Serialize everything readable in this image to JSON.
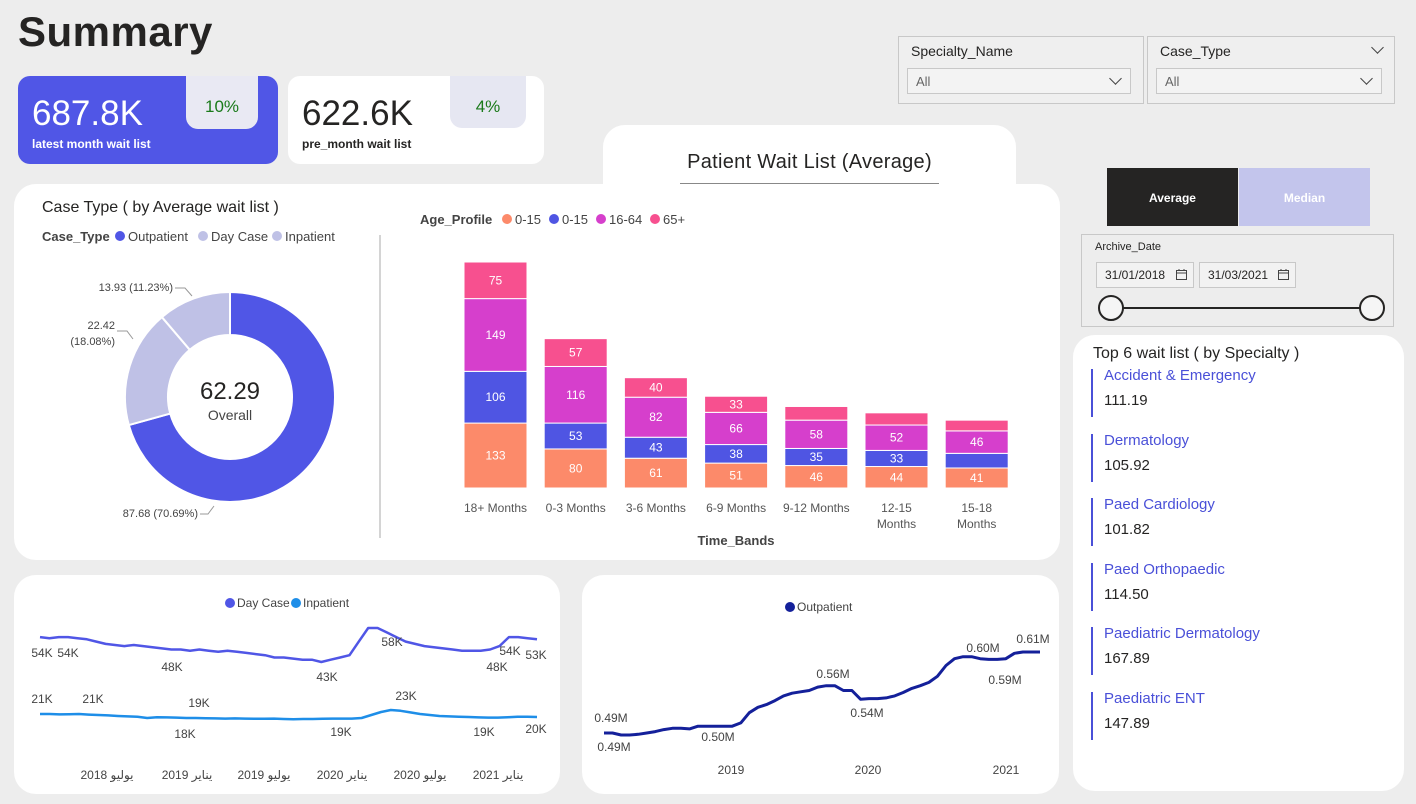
{
  "page": {
    "title": "Summary"
  },
  "kpis": [
    {
      "value": "687.8K",
      "label": "latest month wait list",
      "change": "10%"
    },
    {
      "value": "622.6K",
      "label": "pre_month wait list",
      "change": "4%"
    }
  ],
  "slicers": {
    "specialty": {
      "title": "Specialty_Name",
      "value": "All"
    },
    "case_type": {
      "title": "Case_Type",
      "value": "All"
    }
  },
  "main_title": "Patient Wait List (Average)",
  "stat_toggle": {
    "average": "Average",
    "median": "Median",
    "selected": "Average"
  },
  "date_slicer": {
    "title": "Archive_Date",
    "from": "31/01/2018",
    "to": "31/03/2021"
  },
  "top6": {
    "title": "Top 6 wait list ( by Specialty )",
    "items": [
      {
        "name": "Accident & Emergency",
        "value": "111.19"
      },
      {
        "name": "Dermatology",
        "value": "105.92"
      },
      {
        "name": "Paed Cardiology",
        "value": "101.82"
      },
      {
        "name": "Paed Orthopaedic",
        "value": "114.50"
      },
      {
        "name": "Paediatric Dermatology",
        "value": "167.89"
      },
      {
        "name": "Paediatric ENT",
        "value": "147.89"
      }
    ]
  },
  "colors": {
    "primary": "#5056e6",
    "outpatient": "#5056e6",
    "day_case": "#bfc1e6",
    "inpatient": "#bfc1e6",
    "age_0_15_a": "#fc8a6a",
    "age_0_15_b": "#4f55e3",
    "age_16_64": "#d63fcc",
    "age_65_plus": "#f7508f",
    "line_day_case": "#5056e6",
    "line_inpatient": "#1e8ee8",
    "line_outpatient": "#14209a"
  },
  "chart_data": [
    {
      "type": "pie",
      "title": "Case Type ( by Average wait list )",
      "legend_title": "Case_Type",
      "center_value": "62.29",
      "center_label": "Overall",
      "slices": [
        {
          "name": "Outpatient",
          "value": 87.68,
          "label": "87.68 (70.69%)"
        },
        {
          "name": "Day Case",
          "value": 22.42,
          "label": "22.42\n(18.08%)"
        },
        {
          "name": "Inpatient",
          "value": 13.93,
          "label": "13.93 (11.23%)"
        }
      ]
    },
    {
      "type": "bar",
      "stacked": true,
      "legend_title": "Age_Profile",
      "xlabel": "Time_Bands",
      "categories": [
        "18+ Months",
        "0-3 Months",
        "3-6 Months",
        "6-9 Months",
        "9-12 Months",
        "12-15 Months",
        "15-18 Months"
      ],
      "series": [
        {
          "name": "0-15",
          "values": [
            133,
            80,
            61,
            51,
            46,
            44,
            41
          ],
          "labels": [
            "133",
            "80",
            "61",
            "51",
            "46",
            "44",
            "41"
          ]
        },
        {
          "name": "0-15",
          "values": [
            106,
            53,
            43,
            38,
            35,
            33,
            30
          ],
          "labels": [
            "106",
            "53",
            "43",
            "38",
            "35",
            "33",
            ""
          ]
        },
        {
          "name": "16-64",
          "values": [
            149,
            116,
            82,
            66,
            58,
            52,
            46
          ],
          "labels": [
            "149",
            "116",
            "82",
            "66",
            "58",
            "52",
            "46"
          ]
        },
        {
          "name": "65+",
          "values": [
            75,
            57,
            40,
            33,
            28,
            25,
            22
          ],
          "labels": [
            "75",
            "57",
            "40",
            "33",
            "",
            "",
            ""
          ]
        }
      ]
    },
    {
      "type": "line",
      "x_ticks": [
        "يوليو 2018",
        "يناير 2019",
        "يوليو 2019",
        "يناير 2020",
        "يوليو 2020",
        "يناير 2021"
      ],
      "series": [
        {
          "name": "Day Case",
          "values": [
            54,
            53.5,
            54,
            54,
            53.5,
            53,
            52,
            51,
            50.5,
            50,
            50.5,
            50,
            49.5,
            49,
            48.5,
            48.5,
            48,
            48.5,
            48,
            47.5,
            48,
            47.5,
            47,
            46.5,
            46,
            45,
            45,
            44.5,
            44,
            44,
            43,
            44,
            45,
            46,
            52,
            58,
            58,
            56,
            54,
            52,
            51,
            50,
            49.5,
            49,
            48.5,
            48,
            48,
            48,
            48.5,
            50,
            54,
            54,
            53.5,
            53
          ],
          "point_labels": [
            "54K",
            "54K",
            "48K",
            "43K",
            "58K",
            "48K",
            "54K",
            "53K"
          ]
        },
        {
          "name": "Inpatient",
          "values": [
            21,
            21,
            20.8,
            20.9,
            21,
            20.7,
            20.5,
            20.3,
            20,
            19.8,
            19.6,
            19,
            19.4,
            19.3,
            19.2,
            19,
            19,
            18.9,
            18.8,
            18.7,
            18.8,
            18.7,
            18.6,
            18.6,
            18.7,
            18.5,
            18.4,
            18.5,
            18.5,
            18.6,
            18.7,
            18.7,
            18.7,
            19,
            20.5,
            22,
            23,
            22.6,
            21.8,
            21,
            20.5,
            20,
            19.8,
            19.6,
            19.5,
            19.3,
            19.2,
            19.2,
            19.4,
            19.6,
            19.6,
            19.5
          ],
          "point_labels": [
            "21K",
            "21K",
            "19K",
            "18K",
            "19K",
            "23K",
            "19K",
            "20K"
          ]
        }
      ]
    },
    {
      "type": "line",
      "x_ticks": [
        "2019",
        "2020",
        "2021"
      ],
      "series": [
        {
          "name": "Outpatient",
          "values": [
            0.49,
            0.49,
            0.487,
            0.487,
            0.488,
            0.49,
            0.492,
            0.495,
            0.497,
            0.497,
            0.496,
            0.5,
            0.5,
            0.5,
            0.5,
            0.5,
            0.505,
            0.52,
            0.528,
            0.532,
            0.538,
            0.545,
            0.549,
            0.551,
            0.553,
            0.558,
            0.56,
            0.56,
            0.553,
            0.553,
            0.54,
            0.541,
            0.541,
            0.542,
            0.545,
            0.55,
            0.556,
            0.56,
            0.565,
            0.574,
            0.59,
            0.6,
            0.603,
            0.603,
            0.6,
            0.599,
            0.599,
            0.6,
            0.608,
            0.61,
            0.61,
            0.61
          ],
          "point_labels": [
            "0.49M",
            "0.49M",
            "0.50M",
            "0.56M",
            "0.54M",
            "0.60M",
            "0.59M",
            "0.61M"
          ]
        }
      ]
    }
  ]
}
